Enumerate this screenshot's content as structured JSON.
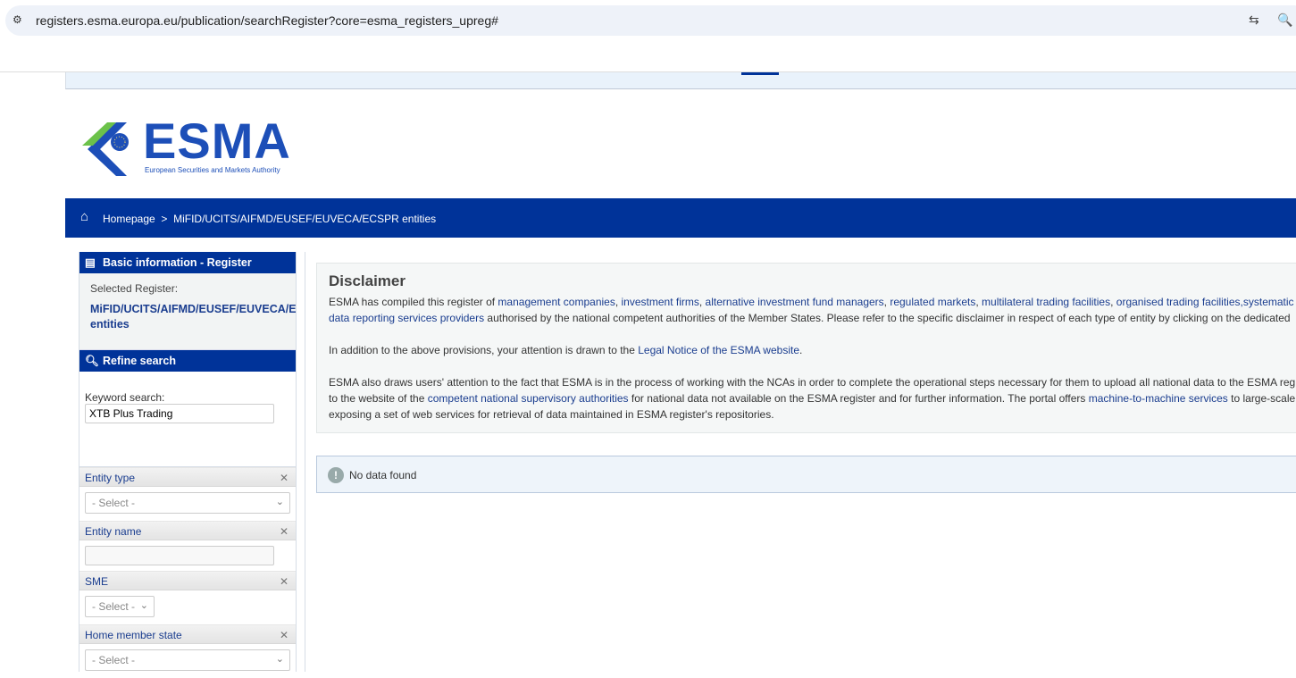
{
  "browser": {
    "url": "registers.esma.europa.eu/publication/searchRegister?core=esma_registers_upreg#"
  },
  "logo": {
    "word": "ESMA",
    "subtitle": "European Securities and Markets Authority"
  },
  "breadcrumb": {
    "home": "Homepage",
    "sep": ">",
    "current": "MiFID/UCITS/AIFMD/EUSEF/EUVECA/ECSPR entities"
  },
  "sidebar": {
    "basic_title": "Basic information - Register",
    "selected_label": "Selected Register:",
    "selected_line1": "MiFID/UCITS/AIFMD/EUSEF/EUVECA/ECSPR",
    "selected_line2": "entities",
    "refine_title": "Refine search",
    "keyword_label": "Keyword search:",
    "keyword_value": "XTB Plus Trading",
    "filters": {
      "entity_type": {
        "label": "Entity type",
        "value": "- Select -"
      },
      "entity_name": {
        "label": "Entity name",
        "value": ""
      },
      "sme": {
        "label": "SME",
        "value": "- Select -"
      },
      "home_member_state": {
        "label": "Home member state",
        "value": "- Select -"
      }
    }
  },
  "disclaimer": {
    "title": "Disclaimer",
    "p1a": "ESMA has compiled this register of ",
    "l1": "management companies",
    "s1": ", ",
    "l2": "investment firms",
    "s2": ", ",
    "l3": "alternative investment fund managers",
    "s3": ", ",
    "l4": "regulated markets",
    "s4": ", ",
    "l5": "multilateral trading facilities",
    "s5": ", ",
    "l6": "organised trading facilities,systematic internalisers",
    "l7": "data reporting services providers",
    "p1b": " authorised by the national competent authorities of the Member States. Please refer to the specific disclaimer in respect of each type of entity by clicking on the dedicated",
    "p2a": "In addition to the above provisions, your attention is drawn to the ",
    "l8": "Legal Notice of the ESMA website",
    "p2b": ".",
    "p3a": "ESMA also draws users' attention to the fact that ESMA is in the process of working with the NCAs in order to complete the operational steps necessary for them to upload all national data to the ESMA register",
    "p3b": "to the website of the ",
    "l9": "competent national supervisory authorities",
    "p3c": " for national data not available on the ESMA register and for further information. The portal offers ",
    "l10": "machine-to-machine services",
    "p3d": " to large-scale users",
    "p3e": "exposing a set of web services for retrieval of data maintained in ESMA register's repositories."
  },
  "result": {
    "message": "No data found"
  }
}
